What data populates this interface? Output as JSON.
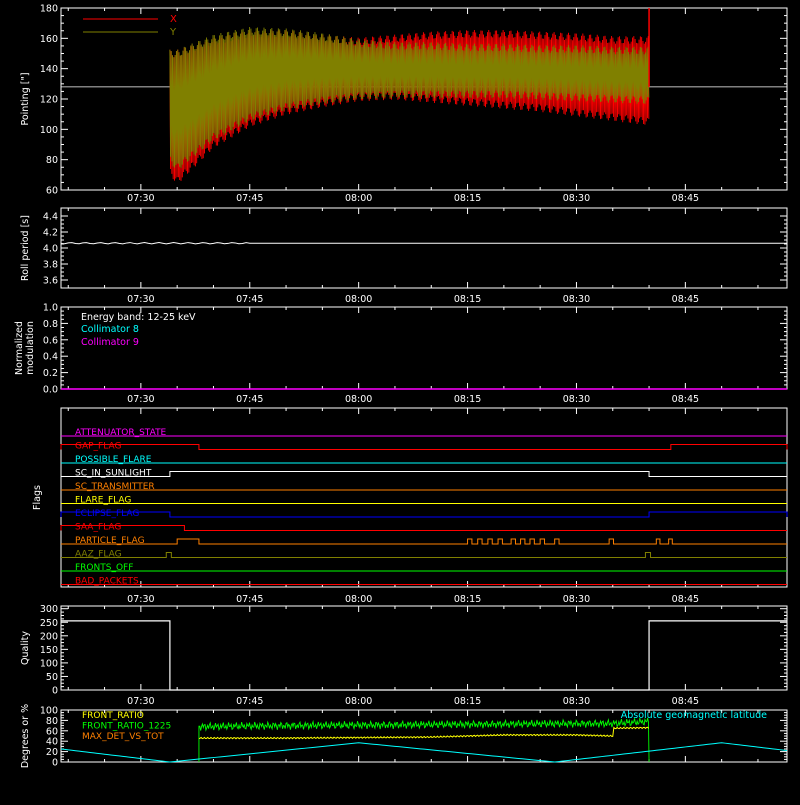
{
  "colors": {
    "background": "#000000",
    "axis": "#ffffff",
    "red": "#ff0000",
    "olive": "#808000",
    "cyan": "#00ffff",
    "magenta": "#ff00ff",
    "orange": "#ff8000",
    "yellow": "#ffff00",
    "blue": "#0000ff",
    "green": "#00ff00",
    "white": "#ffffff"
  },
  "time_ticks": [
    "07:30",
    "07:45",
    "08:00",
    "08:15",
    "08:30",
    "08:45"
  ],
  "chart_data": [
    {
      "type": "line",
      "ylabel": "Pointing [\"]",
      "ylim": [
        60,
        180
      ],
      "yticks": [
        60,
        80,
        100,
        120,
        140,
        160,
        180
      ],
      "xlim": [
        "07:19",
        "08:59"
      ],
      "reference_line": 128,
      "data_start": "07:34",
      "data_end": "08:40",
      "legend": [
        {
          "name": "X",
          "color": "#ff0000"
        },
        {
          "name": "Y",
          "color": "#808000"
        }
      ],
      "series": [
        {
          "name": "X",
          "x": [
            "07:34",
            "07:35",
            "07:40",
            "07:45",
            "07:50",
            "07:55",
            "08:00",
            "08:05",
            "08:10",
            "08:15",
            "08:20",
            "08:25",
            "08:30",
            "08:35",
            "08:40"
          ],
          "upper": [
            150,
            150,
            158,
            163,
            163,
            160,
            158,
            160,
            162,
            163,
            163,
            162,
            161,
            159,
            159
          ],
          "lower": [
            72,
            66,
            90,
            104,
            112,
            117,
            121,
            122,
            120,
            118,
            116,
            114,
            111,
            108,
            105
          ]
        },
        {
          "name": "Y",
          "x": [
            "07:34",
            "07:35",
            "07:40",
            "07:45",
            "07:50",
            "07:55",
            "08:00",
            "08:05",
            "08:10",
            "08:15",
            "08:20",
            "08:25",
            "08:30",
            "08:35",
            "08:40"
          ],
          "upper": [
            150,
            150,
            160,
            165,
            164,
            161,
            157,
            155,
            155,
            154,
            154,
            153,
            153,
            152,
            152
          ],
          "lower": [
            80,
            75,
            95,
            108,
            115,
            119,
            122,
            123,
            123,
            123,
            123,
            122,
            121,
            120,
            119
          ]
        }
      ]
    },
    {
      "type": "line",
      "ylabel": "Roll period [s]",
      "ylim": [
        3.5,
        4.5
      ],
      "yticks": [
        3.6,
        3.8,
        4.0,
        4.2,
        4.4
      ],
      "series": [
        {
          "x": [
            "07:19",
            "08:59"
          ],
          "y": [
            4.06,
            4.06
          ]
        }
      ]
    },
    {
      "type": "line",
      "ylabel": "Normalized modulation",
      "ylabel_lines": [
        "Normalized",
        "modulation"
      ],
      "ylim": [
        0,
        1
      ],
      "yticks": [
        0.0,
        0.2,
        0.4,
        0.6,
        0.8,
        1.0
      ],
      "annotation": "Energy band: 12-25 keV",
      "legend": [
        {
          "name": "Collimator 8",
          "color": "#00ffff"
        },
        {
          "name": "Collimator 9",
          "color": "#ff00ff"
        }
      ],
      "series": [
        {
          "name": "Collimator 9",
          "x": [
            "07:19",
            "08:59"
          ],
          "y": [
            0,
            0
          ]
        }
      ]
    },
    {
      "type": "line",
      "ylabel": "Flags",
      "flags": [
        {
          "name": "ATTENUATOR_STATE",
          "color": "#ff00ff",
          "segments": []
        },
        {
          "name": "GAP_FLAG",
          "color": "#ff0000",
          "segments": [
            [
              "07:19",
              "07:38"
            ],
            [
              "08:43",
              "08:59"
            ]
          ]
        },
        {
          "name": "POSSIBLE_FLARE",
          "color": "#00ffff",
          "segments": []
        },
        {
          "name": "SC_IN_SUNLIGHT",
          "color": "#ffffff",
          "segments": [
            [
              "07:34",
              "08:40"
            ]
          ]
        },
        {
          "name": "SC_TRANSMITTER",
          "color": "#ff8000",
          "segments": []
        },
        {
          "name": "FLARE_FLAG",
          "color": "#ffff00",
          "segments": []
        },
        {
          "name": "ECLIPSE_FLAG",
          "color": "#0000ff",
          "segments": [
            [
              "07:19",
              "07:34"
            ],
            [
              "08:40",
              "08:59"
            ]
          ]
        },
        {
          "name": "SAA_FLAG",
          "color": "#ff0000",
          "segments": [
            [
              "07:19",
              "07:36"
            ]
          ]
        },
        {
          "name": "PARTICLE_FLAG",
          "color": "#ff8000",
          "segments": [
            [
              "07:35",
              "07:38"
            ],
            [
              "08:15",
              "08:15.6"
            ],
            [
              "08:16.4",
              "08:17"
            ],
            [
              "08:17.8",
              "08:18.4"
            ],
            [
              "08:19.2",
              "08:19.8"
            ],
            [
              "08:21",
              "08:21.6"
            ],
            [
              "08:22.3",
              "08:22.9"
            ],
            [
              "08:23.6",
              "08:24.2"
            ],
            [
              "08:25",
              "08:25.6"
            ],
            [
              "08:27",
              "08:27.6"
            ],
            [
              "08:34.5",
              "08:35.1"
            ],
            [
              "08:41",
              "08:41.5"
            ],
            [
              "08:42.7",
              "08:43.2"
            ]
          ]
        },
        {
          "name": "AAZ_FLAG",
          "color": "#808000",
          "segments": [
            [
              "07:33.5",
              "07:34.2"
            ],
            [
              "08:39.5",
              "08:40.2"
            ]
          ]
        },
        {
          "name": "FRONTS_OFF",
          "color": "#00ff00",
          "segments": []
        },
        {
          "name": "BAD_PACKETS",
          "color": "#ff0000",
          "segments": []
        }
      ]
    },
    {
      "type": "line",
      "ylabel": "Quality",
      "ylim": [
        0,
        310
      ],
      "yticks": [
        0,
        50,
        100,
        150,
        200,
        250,
        300
      ],
      "series": [
        {
          "x": [
            "07:19",
            "07:34",
            "07:34",
            "08:40",
            "08:40",
            "08:59"
          ],
          "y": [
            255,
            255,
            0,
            0,
            255,
            255
          ]
        }
      ]
    },
    {
      "type": "line",
      "ylabel": "Degrees or %",
      "ylim": [
        0,
        100
      ],
      "yticks": [
        0,
        20,
        40,
        60,
        80,
        100
      ],
      "legend": [
        {
          "name": "FRONT_RATIO",
          "color": "#ffff00"
        },
        {
          "name": "FRONT_RATIO_1225",
          "color": "#00ff00"
        },
        {
          "name": "MAX_DET_VS_TOT",
          "color": "#ff8000"
        }
      ],
      "right_label": "Absolute geomagnetic latitude",
      "series": [
        {
          "name": "FRONT_RATIO",
          "x": [
            "07:38",
            "07:50",
            "08:00",
            "08:10",
            "08:20",
            "08:30",
            "08:35",
            "08:35",
            "08:40"
          ],
          "y": [
            46,
            46,
            47,
            48,
            52,
            52,
            50,
            65,
            66
          ]
        },
        {
          "name": "FRONT_RATIO_1225",
          "x": [
            "07:38",
            "07:50",
            "08:00",
            "08:10",
            "08:20",
            "08:30",
            "08:35",
            "08:40"
          ],
          "y": [
            68,
            70,
            71,
            72,
            73,
            74,
            74,
            78
          ]
        },
        {
          "name": "Absolute geomagnetic latitude",
          "x": [
            "07:19",
            "07:34",
            "08:00",
            "08:27",
            "08:50",
            "08:59"
          ],
          "y": [
            25,
            0,
            37,
            0,
            37,
            22
          ]
        }
      ]
    }
  ]
}
